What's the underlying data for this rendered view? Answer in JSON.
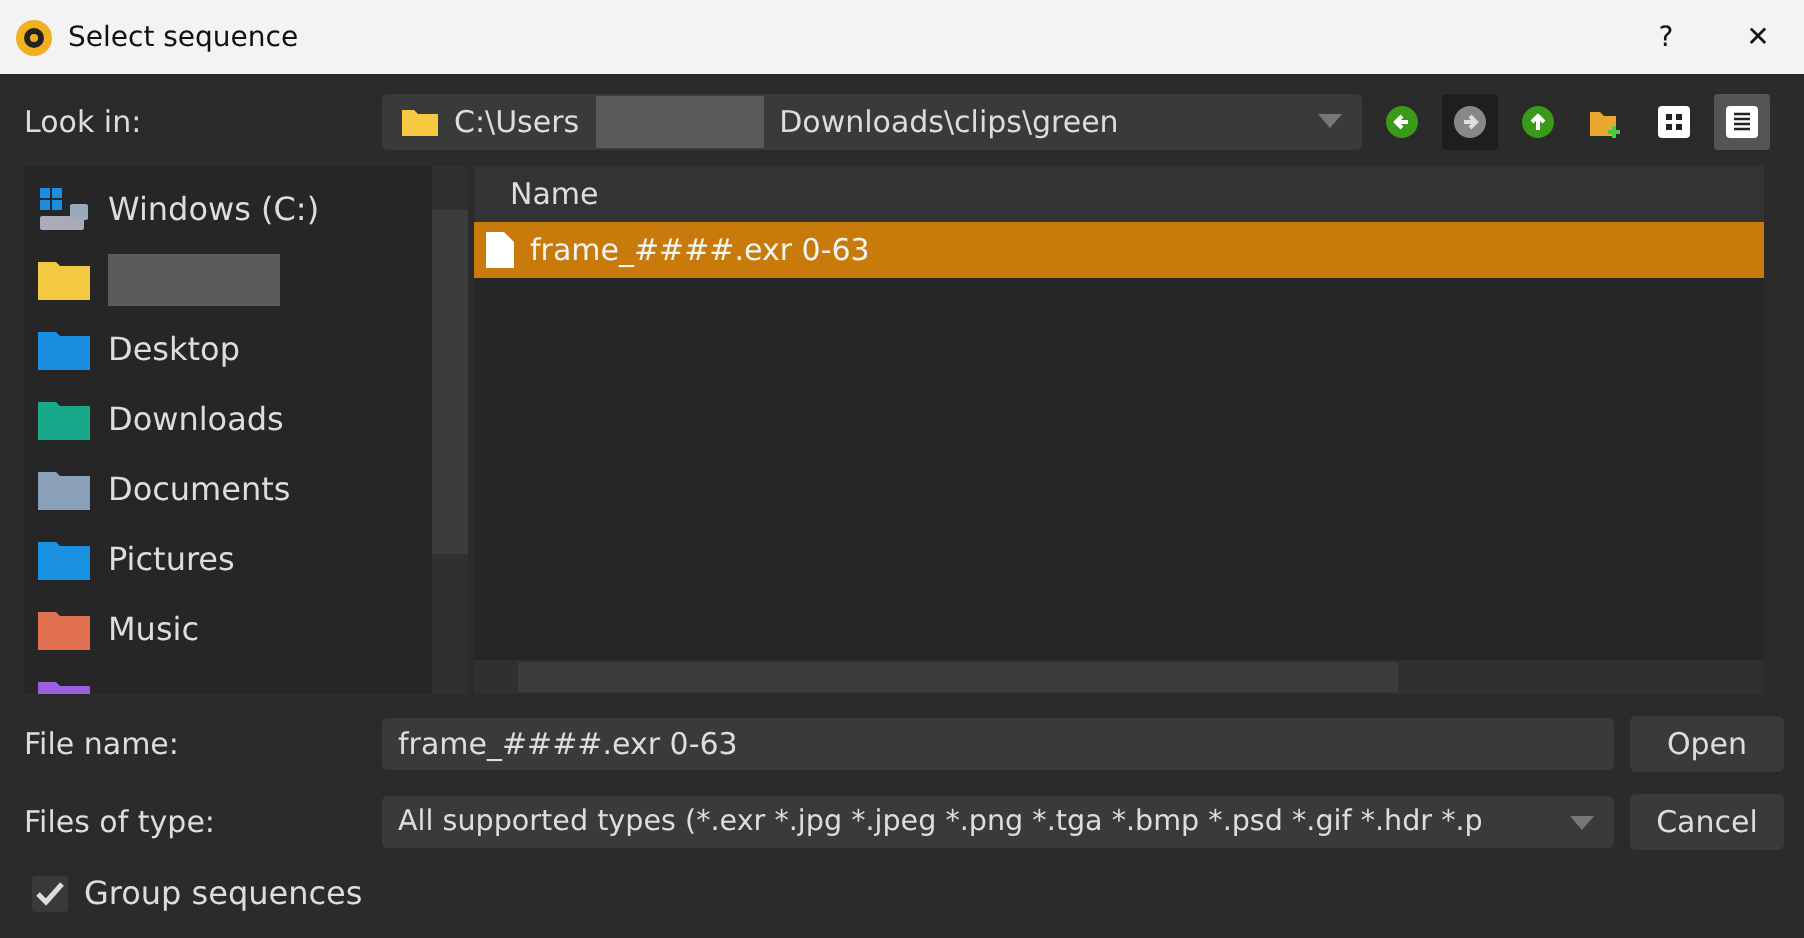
{
  "window": {
    "title": "Select sequence",
    "help": "?",
    "close": "✕"
  },
  "look_in": {
    "label": "Look in:",
    "path_start": "C:\\Users",
    "path_end": "Downloads\\clips\\green"
  },
  "toolbar": [
    {
      "kind": "back",
      "disabled": false,
      "selected": false
    },
    {
      "kind": "forward",
      "disabled": true,
      "selected": false
    },
    {
      "kind": "up",
      "disabled": false,
      "selected": false
    },
    {
      "kind": "newfolder",
      "disabled": false,
      "selected": false
    },
    {
      "kind": "icons",
      "disabled": false,
      "selected": false
    },
    {
      "kind": "details",
      "disabled": false,
      "selected": true
    }
  ],
  "sidebar": {
    "items": [
      {
        "kind": "drive",
        "label": "Windows (C:)"
      },
      {
        "kind": "hidden"
      },
      {
        "kind": "desktop",
        "label": "Desktop"
      },
      {
        "kind": "downloads",
        "label": "Downloads"
      },
      {
        "kind": "documents",
        "label": "Documents"
      },
      {
        "kind": "pictures",
        "label": "Pictures"
      },
      {
        "kind": "music",
        "label": "Music"
      },
      {
        "kind": "videos"
      }
    ]
  },
  "table": {
    "columns": [
      "Name"
    ],
    "rows": [
      {
        "name": "frame_####.exr 0-63",
        "selected": true
      }
    ]
  },
  "file_name": {
    "label": "File name:",
    "value": "frame_####.exr 0-63"
  },
  "file_type": {
    "label": "Files of type:",
    "value": "All supported types (*.exr *.jpg *.jpeg *.png *.tga *.bmp *.psd *.gif *.hdr *.p"
  },
  "buttons": [
    "Open",
    "Cancel"
  ],
  "group_sequences": {
    "label": "Group sequences",
    "checked": true
  }
}
